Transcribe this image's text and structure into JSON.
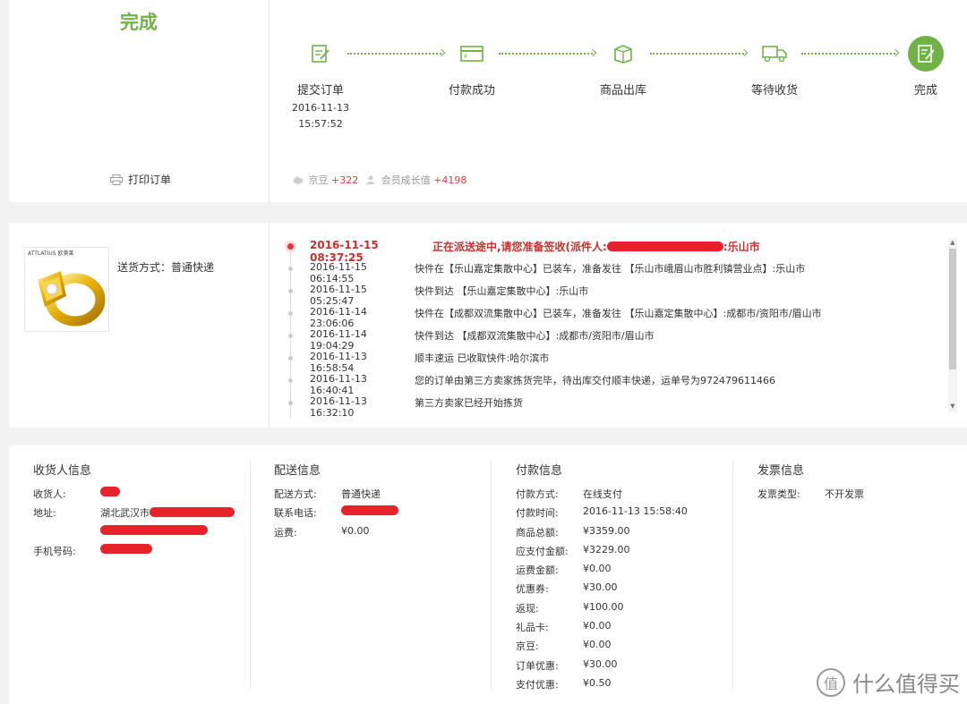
{
  "status": {
    "title": "完成",
    "print_label": "打印订单"
  },
  "steps": [
    {
      "label": "提交订单",
      "date": "2016-11-13",
      "time": "15:57:52",
      "icon": "edit-order-icon"
    },
    {
      "label": "付款成功",
      "date": "",
      "time": "",
      "icon": "payment-card-icon"
    },
    {
      "label": "商品出库",
      "date": "",
      "time": "",
      "icon": "box-icon"
    },
    {
      "label": "等待收货",
      "date": "",
      "time": "",
      "icon": "truck-icon"
    },
    {
      "label": "完成",
      "date": "",
      "time": "",
      "icon": "complete-icon"
    }
  ],
  "rewards": {
    "jingdou_label": "京豆",
    "jingdou_value": "+322",
    "growth_label": "会员成长值",
    "growth_value": "+4198"
  },
  "product": {
    "brand": "ATTLATIUS 欧美莱",
    "delivery_method": "送货方式：普通快递"
  },
  "tracking": {
    "current": {
      "time": "2016-11-15 08:37:25",
      "msg_prefix": "正在派送途中,请您准备签收(派件人:",
      "msg_suffix": ":乐山市"
    },
    "events": [
      {
        "time": "2016-11-15 06:14:55",
        "msg": "快件在【乐山嘉定集散中心】已装车，准备发往 【乐山市峨眉山市胜利镇营业点】:乐山市"
      },
      {
        "time": "2016-11-15 05:25:47",
        "msg": "快件到达 【乐山嘉定集散中心】:乐山市"
      },
      {
        "time": "2016-11-14 23:06:06",
        "msg": "快件在【成都双流集散中心】已装车，准备发往 【乐山嘉定集散中心】:成都市/资阳市/眉山市"
      },
      {
        "time": "2016-11-14 19:04:29",
        "msg": "快件到达 【成都双流集散中心】:成都市/资阳市/眉山市"
      },
      {
        "time": "2016-11-13 16:58:54",
        "msg": "顺丰速运 已收取快件:哈尔滨市"
      },
      {
        "time": "2016-11-13 16:40:41",
        "msg": "您的订单由第三方卖家拣货完毕，待出库交付顺丰快递，运单号为972479611466"
      },
      {
        "time": "2016-11-13 16:32:10",
        "msg": "第三方卖家已经开始拣货"
      }
    ]
  },
  "consignee": {
    "title": "收货人信息",
    "name_label": "收货人:",
    "address_label": "地址:",
    "address_value": "湖北武汉市",
    "phone_label": "手机号码:"
  },
  "shipping": {
    "title": "配送信息",
    "method_label": "配送方式:",
    "method_value": "普通快递",
    "phone_label": "联系电话:",
    "fee_label": "运费:",
    "fee_value": "¥0.00"
  },
  "payment": {
    "title": "付款信息",
    "rows": [
      {
        "k": "付款方式:",
        "v": "在线支付"
      },
      {
        "k": "付款时间:",
        "v": "2016-11-13 15:58:40"
      },
      {
        "k": "商品总额:",
        "v": "¥3359.00"
      },
      {
        "k": "应支付金额:",
        "v": "¥3229.00"
      },
      {
        "k": "运费金额:",
        "v": "¥0.00"
      },
      {
        "k": "优惠券:",
        "v": "¥30.00"
      },
      {
        "k": "返现:",
        "v": "¥100.00"
      },
      {
        "k": "礼品卡:",
        "v": "¥0.00"
      },
      {
        "k": "京豆:",
        "v": "¥0.00"
      },
      {
        "k": "订单优惠:",
        "v": "¥30.00"
      },
      {
        "k": "支付优惠:",
        "v": "¥0.50"
      }
    ]
  },
  "invoice": {
    "title": "发票信息",
    "type_label": "发票类型:",
    "type_value": "不开发票"
  },
  "watermark": {
    "logo": "值",
    "text": "什么值得买"
  },
  "colors": {
    "accent_green": "#71b247",
    "alert_red": "#e4393c",
    "redaction_red": "#e8222a"
  }
}
